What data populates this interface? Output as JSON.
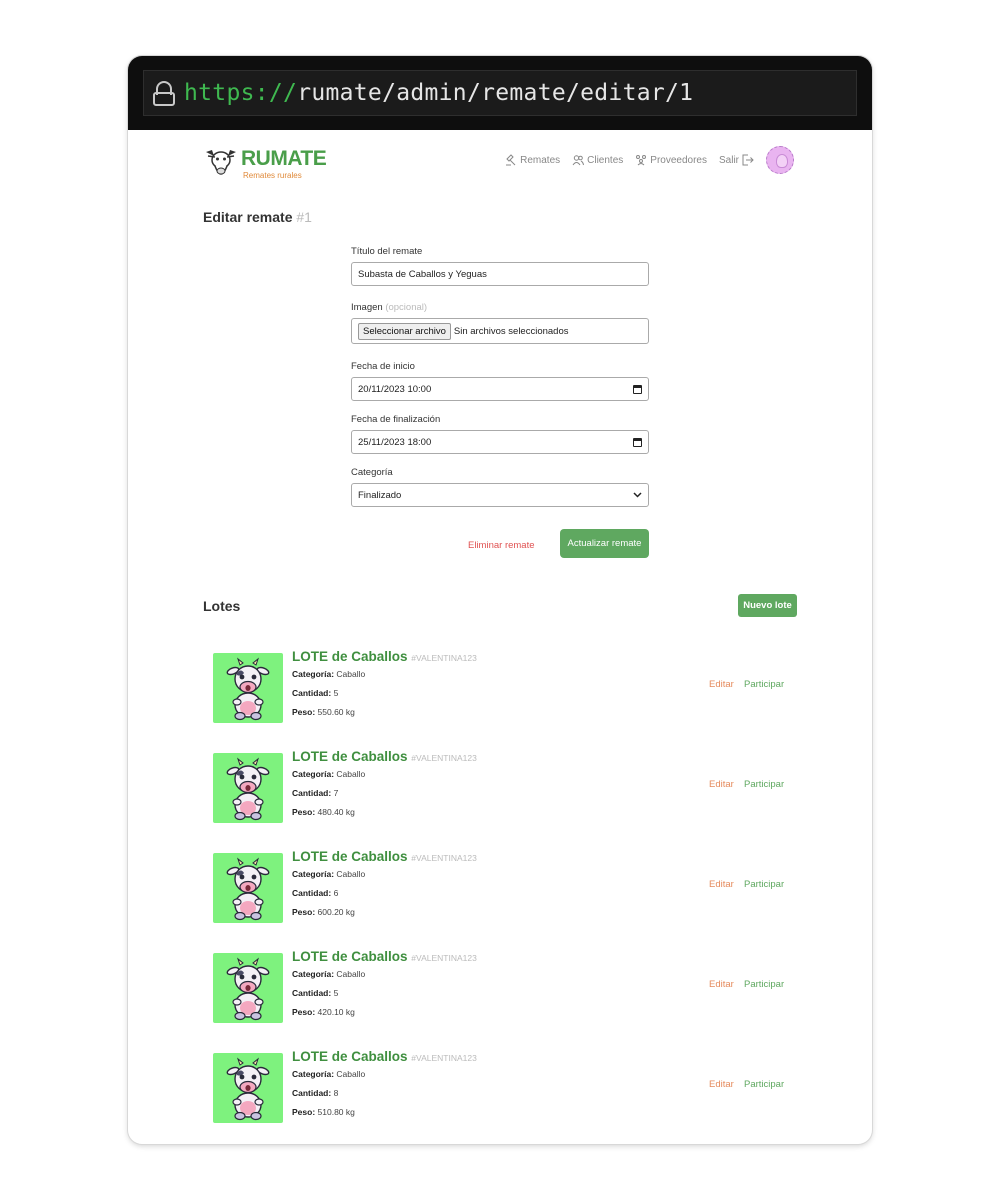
{
  "browser": {
    "url_scheme": "https://",
    "url_rest": "rumate/admin/remate/editar/1"
  },
  "header": {
    "logo_text": "RUMATE",
    "logo_sub": "Remates rurales",
    "nav": [
      {
        "label": "Remates",
        "icon": "gavel-icon"
      },
      {
        "label": "Clientes",
        "icon": "users-icon"
      },
      {
        "label": "Proveedores",
        "icon": "providers-icon"
      },
      {
        "label": "Salir",
        "icon": "logout-icon"
      }
    ]
  },
  "page": {
    "title": "Editar remate",
    "id": "#1"
  },
  "form": {
    "title_label": "Título del remate",
    "title_value": "Subasta de Caballos y Yeguas",
    "image_label": "Imagen",
    "image_optional": "(opcional)",
    "file_button": "Seleccionar archivo",
    "file_status": "Sin archivos seleccionados",
    "start_label": "Fecha de inicio",
    "start_value": "20/11/2023 10:00",
    "end_label": "Fecha de finalización",
    "end_value": "25/11/2023 18:00",
    "category_label": "Categoría",
    "category_value": "Finalizado",
    "delete_label": "Eliminar remate",
    "update_label": "Actualizar remate"
  },
  "lots": {
    "title": "Lotes",
    "new_label": "Nuevo lote",
    "category_key": "Categoría:",
    "quantity_key": "Cantidad:",
    "weight_key": "Peso:",
    "edit_label": "Editar",
    "participate_label": "Participar",
    "items": [
      {
        "name": "LOTE de Caballos",
        "code": "#VALENTINA123",
        "category": "Caballo",
        "quantity": "5",
        "weight": "550.60 kg"
      },
      {
        "name": "LOTE de Caballos",
        "code": "#VALENTINA123",
        "category": "Caballo",
        "quantity": "7",
        "weight": "480.40 kg"
      },
      {
        "name": "LOTE de Caballos",
        "code": "#VALENTINA123",
        "category": "Caballo",
        "quantity": "6",
        "weight": "600.20 kg"
      },
      {
        "name": "LOTE de Caballos",
        "code": "#VALENTINA123",
        "category": "Caballo",
        "quantity": "5",
        "weight": "420.10 kg"
      },
      {
        "name": "LOTE de Caballos",
        "code": "#VALENTINA123",
        "category": "Caballo",
        "quantity": "8",
        "weight": "510.80 kg"
      }
    ]
  },
  "colors": {
    "brand_green": "#5fa860",
    "accent_orange": "#e58a5c",
    "danger_red": "#e05252",
    "lot_image_bg": "#7ef27e"
  }
}
